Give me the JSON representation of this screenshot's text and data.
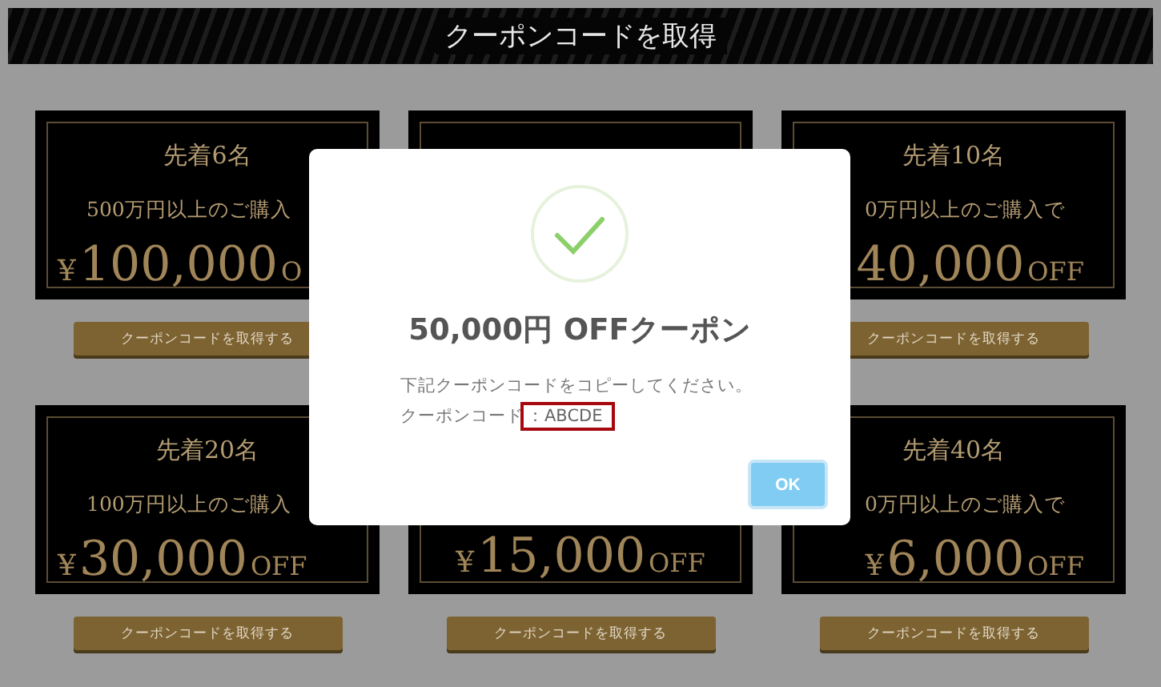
{
  "header": {
    "title": "クーポンコードを取得"
  },
  "coupons": [
    {
      "kind": "coupon",
      "title": "先着6名",
      "condition": "500万円以上のご購入",
      "yen": "¥",
      "amount": "100,000",
      "off": "O",
      "button": "クーポンコードを取得する"
    },
    {
      "kind": "coupon"
    },
    {
      "kind": "coupon",
      "title": "先着10名",
      "condition": "0万円以上のご購入で",
      "amount": "40,000",
      "off": "OFF",
      "button": "クーポンコードを取得する"
    },
    {
      "kind": "coupon",
      "title": "先着20名",
      "condition": "100万円以上のご購入",
      "yen": "¥",
      "amount": "30,000",
      "off": "OFF",
      "button": "クーポンコードを取得する"
    },
    {
      "kind": "coupon",
      "yen": "¥",
      "amount": "15,000",
      "off": "OFF",
      "button": "クーポンコードを取得する"
    },
    {
      "kind": "coupon",
      "title": "先着40名",
      "condition": "0万円以上のご購入で",
      "yen": "¥",
      "amount": "6,000",
      "off": "OFF",
      "button": "クーポンコードを取得する"
    }
  ],
  "dialog": {
    "title": "50,000円 OFFクーポン",
    "message": "下記クーポンコードをコピーしてください。",
    "code_label": "クーポンコード",
    "code": "：ABCDE",
    "ok": "OK"
  }
}
